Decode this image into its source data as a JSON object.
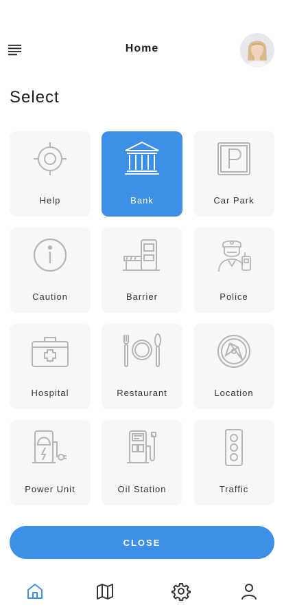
{
  "header": {
    "title": "Home",
    "menu_icon": "hamburger-menu-icon",
    "avatar_icon": "user-avatar"
  },
  "section_title": "Select",
  "tiles": [
    {
      "label": "Help",
      "icon": "crosshair-icon",
      "active": false
    },
    {
      "label": "Bank",
      "icon": "bank-icon",
      "active": true
    },
    {
      "label": "Car Park",
      "icon": "parking-icon",
      "active": false
    },
    {
      "label": "Caution",
      "icon": "info-icon",
      "active": false
    },
    {
      "label": "Barrier",
      "icon": "barrier-icon",
      "active": false
    },
    {
      "label": "Police",
      "icon": "police-icon",
      "active": false
    },
    {
      "label": "Hospital",
      "icon": "first-aid-kit-icon",
      "active": false
    },
    {
      "label": "Restaurant",
      "icon": "plate-cutlery-icon",
      "active": false
    },
    {
      "label": "Location",
      "icon": "compass-icon",
      "active": false
    },
    {
      "label": "Power Unit",
      "icon": "ev-charger-icon",
      "active": false
    },
    {
      "label": "Oil Station",
      "icon": "fuel-pump-icon",
      "active": false
    },
    {
      "label": "Traffic",
      "icon": "traffic-light-icon",
      "active": false
    }
  ],
  "close_button": {
    "label": "CLOSE"
  },
  "tabbar": {
    "items": [
      {
        "name": "home",
        "icon": "home-icon",
        "active": true
      },
      {
        "name": "map",
        "icon": "map-icon",
        "active": false
      },
      {
        "name": "settings",
        "icon": "gear-icon",
        "active": false
      },
      {
        "name": "profile",
        "icon": "user-icon",
        "active": false
      }
    ]
  },
  "colors": {
    "accent": "#3d8fe8",
    "tile_bg": "#f7f7f7",
    "icon_gray": "#b5b5b5",
    "text": "#333333"
  }
}
